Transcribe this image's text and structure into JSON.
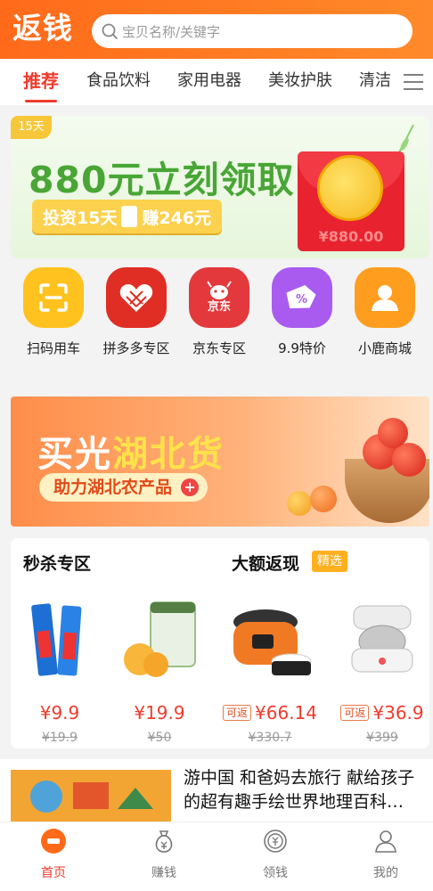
{
  "header": {
    "logo": "返钱",
    "search_placeholder": "宝贝名称/关键字"
  },
  "tabs": [
    {
      "label": "推荐",
      "active": true
    },
    {
      "label": "食品饮料"
    },
    {
      "label": "家用电器"
    },
    {
      "label": "美妆护肤"
    },
    {
      "label": "清洁"
    }
  ],
  "banner1": {
    "badge": "15天",
    "title": "880元立刻领取",
    "pill_left": "投资15天",
    "pill_right": "赚246元",
    "amount": "¥880.00"
  },
  "quick_icons": [
    {
      "label": "扫码用车",
      "icon": "scan-icon",
      "color": "#ffc21e"
    },
    {
      "label": "拼多多专区",
      "icon": "pinduoduo-icon",
      "color": "#e02e24"
    },
    {
      "label": "京东专区",
      "icon": "jd-icon",
      "color": "#e4393c",
      "logo_text": "京东"
    },
    {
      "label": "9.9特价",
      "icon": "discount-tag-icon",
      "color": "#a95bf0"
    },
    {
      "label": "小鹿商城",
      "icon": "user-group-icon",
      "color": "#ff9d1f"
    }
  ],
  "banner2": {
    "title_a": "买光",
    "title_b": "湖北货",
    "subtitle": "助力湖北农产品"
  },
  "deals": {
    "left_title": "秒杀专区",
    "right_title": "大额返现",
    "right_tag": "精选",
    "rebate_label": "可返",
    "products": [
      {
        "price": "¥9.9",
        "old_price": "¥19.9",
        "rebate": false
      },
      {
        "price": "¥19.9",
        "old_price": "¥50",
        "rebate": false
      },
      {
        "price": "¥66.14",
        "old_price": "¥330.7",
        "rebate": true
      },
      {
        "price": "¥36.9",
        "old_price": "¥399",
        "rebate": true
      }
    ]
  },
  "article": {
    "title": "游中国 和爸妈去旅行 献给孩子的超有趣手绘世界地理百科…"
  },
  "bottom_nav": [
    {
      "label": "首页",
      "icon": "home-logo-icon",
      "active": true
    },
    {
      "label": "赚钱",
      "icon": "money-bag-icon"
    },
    {
      "label": "领钱",
      "icon": "coin-icon"
    },
    {
      "label": "我的",
      "icon": "profile-icon"
    }
  ],
  "colors": {
    "brand": "#ff6a1a",
    "accent_red": "#ef3b2d"
  }
}
